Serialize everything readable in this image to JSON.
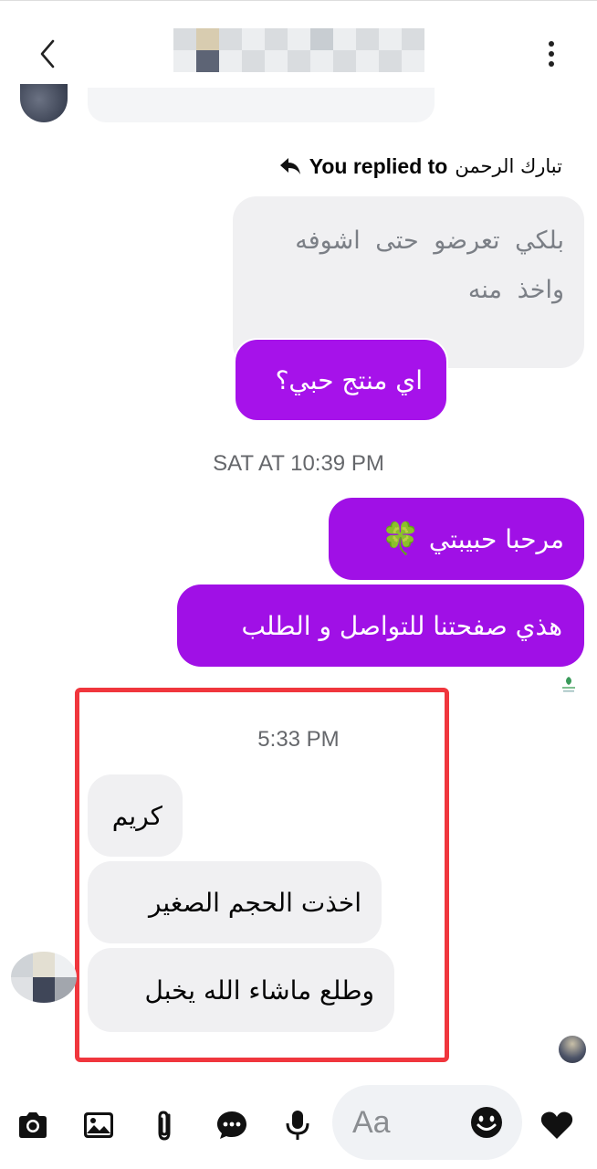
{
  "header": {
    "back_icon": "chevron-left-icon",
    "more_icon": "vertical-dots-icon"
  },
  "reply": {
    "label": "You replied to",
    "name": "تبارك الرحمن",
    "icon": "reply-arrow-icon"
  },
  "quoted_message": {
    "line1": "بلكي تعرضو حتى اشوفه",
    "line2": "واخذ منه"
  },
  "messages_sent_1": {
    "product_question": "اي منتج حبي؟"
  },
  "timestamp_1": "SAT AT 10:39 PM",
  "messages_sent_2": {
    "greeting": "مرحبا حبيبتي",
    "greeting_emoji": "🍀",
    "page_message": "هذي صفحتنا للتواصل و الطلب"
  },
  "timestamp_2": "5:33 PM",
  "messages_received": [
    {
      "text": "كريم"
    },
    {
      "text": "اخذت الحجم الصغير"
    },
    {
      "text": "وطلع ماشاء الله يخبل"
    }
  ],
  "composer": {
    "placeholder": "Aa",
    "icons": [
      "camera-icon",
      "gallery-icon",
      "attachment-icon",
      "chat-bubble-icon",
      "microphone-icon",
      "emoji-icon",
      "heart-icon"
    ]
  },
  "colors": {
    "sent_bubble": "#a010e6",
    "received_bubble": "#f0f0f2",
    "highlight": "#f0363d",
    "timestamp": "#65676b"
  }
}
